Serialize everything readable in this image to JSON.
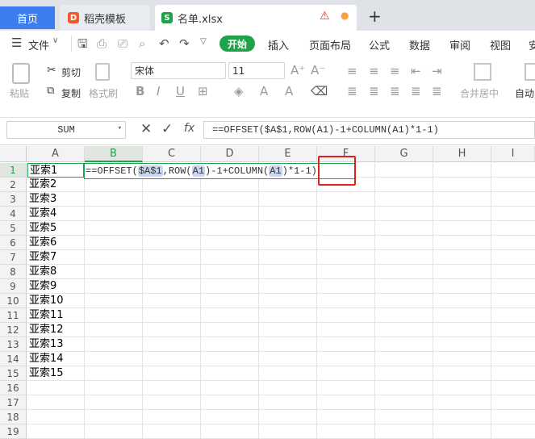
{
  "tabs": {
    "home": "首页",
    "daoke": "稻壳模板",
    "file": "名单.xlsx",
    "new_tab": "+",
    "warning_icon": "warning-icon"
  },
  "menu": {
    "file": "文件",
    "items": [
      "开始",
      "插入",
      "页面布局",
      "公式",
      "数据",
      "审阅",
      "视图",
      "安"
    ]
  },
  "ribbon": {
    "paste": "粘贴",
    "cut": "剪切",
    "copy": "复制",
    "format_painter": "格式刷",
    "font_name": "宋体",
    "font_size": "11",
    "merge_center": "合并居中",
    "auto_wrap": "自动"
  },
  "formula_bar": {
    "name_box": "SUM",
    "fx": "fx",
    "formula": "==OFFSET($A$1,ROW(A1)-1+COLUMN(A1)*1-1)"
  },
  "columns": [
    "A",
    "B",
    "C",
    "D",
    "E",
    "F",
    "G",
    "H",
    "I"
  ],
  "rows": [
    "1",
    "2",
    "3",
    "4",
    "5",
    "6",
    "7",
    "8",
    "9",
    "10",
    "11",
    "12",
    "13",
    "14",
    "15",
    "16",
    "17",
    "18",
    "19"
  ],
  "column_a": [
    "亚索1",
    "亚索2",
    "亚索3",
    "亚索4",
    "亚索5",
    "亚索6",
    "亚索7",
    "亚索8",
    "亚索9",
    "亚索10",
    "亚索11",
    "亚索12",
    "亚索13",
    "亚索14",
    "亚索15"
  ],
  "edit_cell": {
    "p1": "==OFFSET(",
    "ref1": "$A$1",
    "p2": ",ROW(",
    "ref2": "A1",
    "p3": ")-1+COLUMN(",
    "ref3": "A1",
    "p4": ")*1-1)"
  },
  "colors": {
    "accent_green": "#1fa34a",
    "home_tab_blue": "#3c7df0",
    "highlight_red": "#e0201b",
    "reference_blue": "#c9d6f2"
  }
}
